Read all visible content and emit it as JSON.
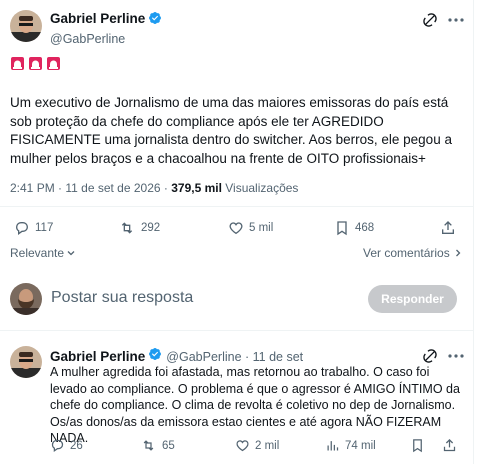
{
  "main_tweet": {
    "author_name": "Gabriel Perline",
    "handle": "@GabPerline",
    "alert_emojis": "🚨🚨🚨",
    "text": "Um executivo de Jornalismo de uma das maiores emissoras do país está sob proteção da chefe do compliance após ele ter AGREDIDO FISICAMENTE uma jornalista dentro do switcher. Aos berros, ele pegou a mulher pelos braços e a chacoalhou na frente de OITO profissionais+",
    "time": "2:41 PM · 11 de set de 2026 · ",
    "views_count": "379,5 mil",
    "views_label": " Visualizações",
    "replies": "117",
    "retweets": "292",
    "likes": "5 mil",
    "bookmarks": "468"
  },
  "sort": {
    "relevant_label": "Relevante",
    "more_replies_label": "Ver comentários"
  },
  "compose": {
    "placeholder": "Postar sua resposta",
    "reply_button": "Responder"
  },
  "reply_tweet": {
    "author_name": "Gabriel Perline",
    "handle": "@GabPerline · 11 de set",
    "text": "A mulher agredida foi afastada, mas retornou ao trabalho. O caso foi levado ao compliance. O problema é que o agressor é AMIGO ÍNTIMO da chefe do compliance. O clima de revolta é coletivo no dep de Jornalismo. Os/as donos/as da emissora estao cientes e até agora NÃO FIZERAM NADA.",
    "replies": "26",
    "retweets": "65",
    "likes": "2 mil",
    "views": "74 mil"
  },
  "colors": {
    "accent": "#1d9bf0",
    "muted": "#536471",
    "button_disabled": "#c7c9cc"
  }
}
